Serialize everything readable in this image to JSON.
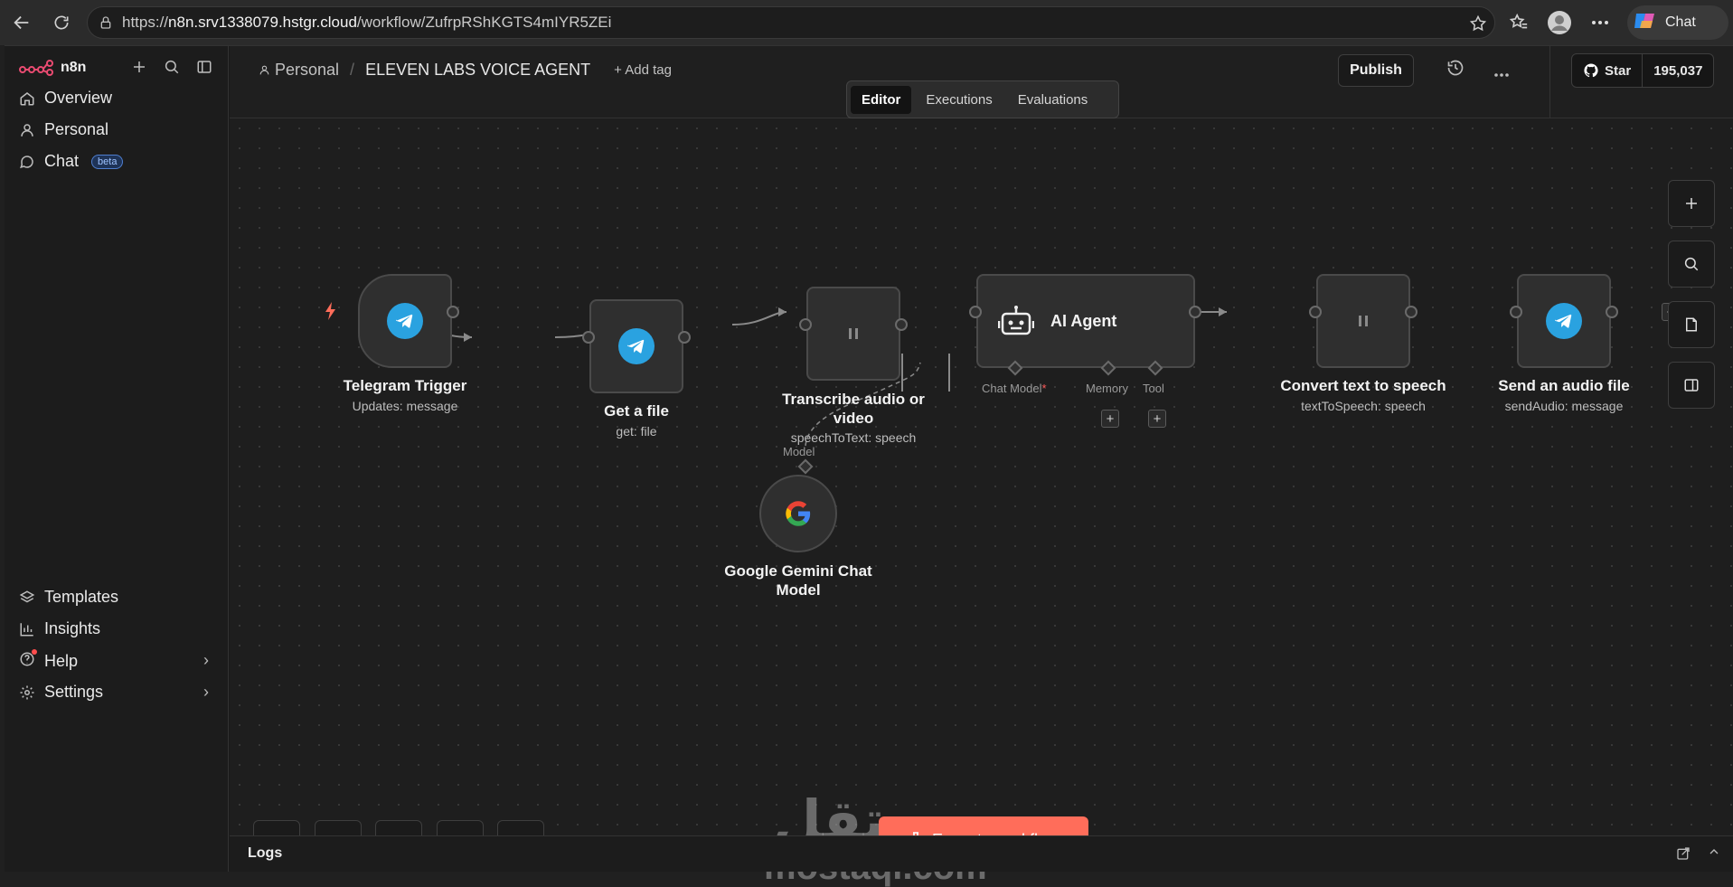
{
  "browser": {
    "url_prefix": "https://",
    "url_host": "n8n.srv1338079.hstgr.cloud",
    "url_path": "/workflow/ZufrpRShKGTS4mIYR5ZEi",
    "copilot_label": "Chat"
  },
  "sidebar": {
    "brand": "n8n",
    "items_top": [
      {
        "label": "Overview"
      },
      {
        "label": "Personal"
      },
      {
        "label": "Chat",
        "badge": "beta"
      }
    ],
    "items_bottom": [
      {
        "label": "Templates"
      },
      {
        "label": "Insights"
      },
      {
        "label": "Help"
      },
      {
        "label": "Settings"
      }
    ]
  },
  "header": {
    "project": "Personal",
    "separator": "/",
    "workflow_name": "ELEVEN LABS VOICE AGENT",
    "add_tag": "+ Add tag",
    "publish": "Publish",
    "github_star": "Star",
    "github_count": "195,037",
    "tabs": [
      "Editor",
      "Executions",
      "Evaluations"
    ],
    "active_tab": "Editor"
  },
  "nodes": {
    "telegram_trigger": {
      "title": "Telegram Trigger",
      "subtitle": "Updates: message"
    },
    "get_file": {
      "title": "Get a file",
      "subtitle": "get: file"
    },
    "transcribe": {
      "title_line1": "Transcribe audio or",
      "title_line2": "video",
      "subtitle": "speechToText: speech"
    },
    "ai_agent": {
      "title": "AI Agent",
      "ports": {
        "chat_model": "Chat Model",
        "required_mark": "*",
        "memory": "Memory",
        "tool": "Tool"
      }
    },
    "tts": {
      "title": "Convert text to speech",
      "subtitle": "textToSpeech: speech"
    },
    "send_audio": {
      "title": "Send an audio file",
      "subtitle": "sendAudio: message"
    },
    "gemini": {
      "title_line1": "Google Gemini Chat",
      "title_line2": "Model",
      "port_label": "Model"
    }
  },
  "actions": {
    "execute": "Execute workflow"
  },
  "logs": {
    "label": "Logs"
  },
  "watermark": {
    "arabic": "مستقل",
    "latin": "mostaql.com"
  },
  "colors": {
    "accent": "#ff6d5a",
    "telegram": "#2aa2e0",
    "canvas": "#1e1e1e"
  }
}
